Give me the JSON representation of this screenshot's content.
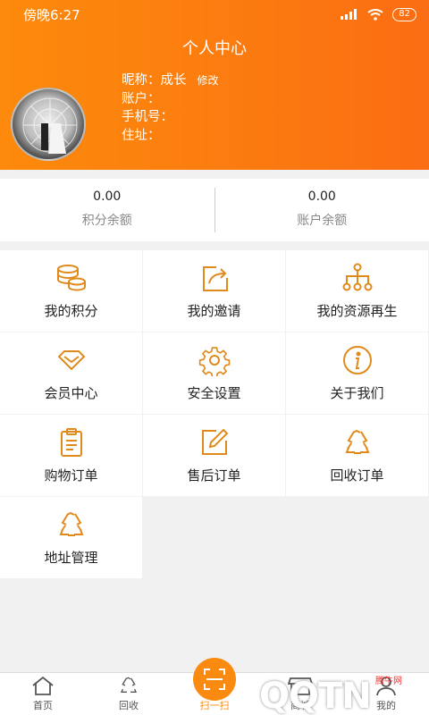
{
  "status": {
    "time": "傍晚6:27",
    "signal": "4G",
    "battery": "82"
  },
  "header": {
    "title": "个人中心"
  },
  "user": {
    "nickname_label": "昵称：成长",
    "edit_label": "修改",
    "account_label": "账户：",
    "phone_label": "手机号：",
    "address_label": "住址："
  },
  "balance": [
    {
      "value": "0.00",
      "label": "积分余额"
    },
    {
      "value": "0.00",
      "label": "账户余额"
    }
  ],
  "menu": [
    {
      "label": "我的积分",
      "icon": "coins-icon"
    },
    {
      "label": "我的邀请",
      "icon": "share-icon"
    },
    {
      "label": "我的资源再生",
      "icon": "hierarchy-icon"
    },
    {
      "label": "会员中心",
      "icon": "diamond-icon"
    },
    {
      "label": "安全设置",
      "icon": "gear-icon"
    },
    {
      "label": "关于我们",
      "icon": "info-icon"
    },
    {
      "label": "购物订单",
      "icon": "clipboard-icon"
    },
    {
      "label": "售后订单",
      "icon": "edit-icon"
    },
    {
      "label": "回收订单",
      "icon": "recycle-icon"
    },
    {
      "label": "地址管理",
      "icon": "recycle-icon"
    }
  ],
  "tabs": [
    {
      "label": "首页",
      "icon": "home-icon"
    },
    {
      "label": "回收",
      "icon": "recycle-icon"
    },
    {
      "label": "扫一扫",
      "icon": "scan-icon"
    },
    {
      "label": "商城",
      "icon": "store-icon"
    },
    {
      "label": "我的",
      "icon": "user-icon"
    }
  ],
  "watermark": {
    "logo": "QQTN",
    "small": "腾牛网"
  },
  "colors": {
    "accent": "#fb8b10",
    "icon": "#e08a1c"
  }
}
